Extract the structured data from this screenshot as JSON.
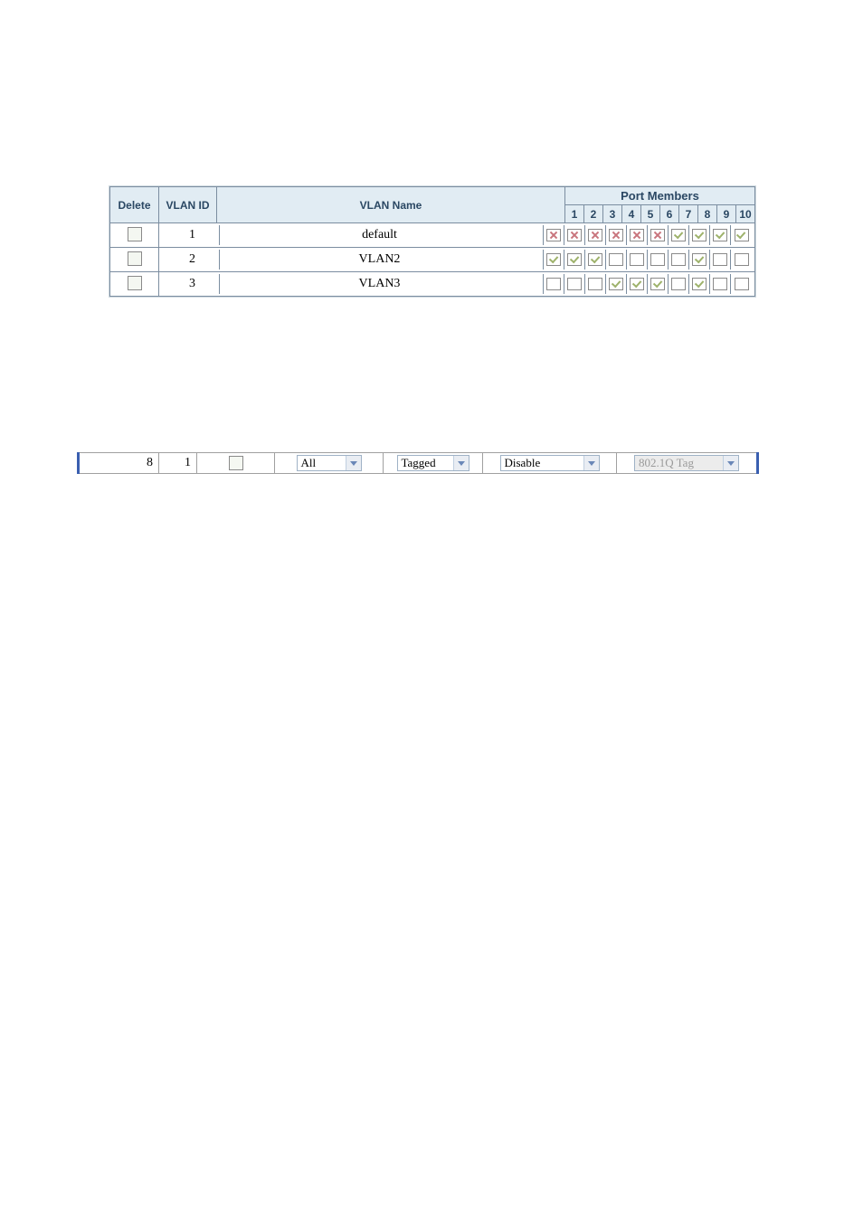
{
  "table": {
    "headers": {
      "delete": "Delete",
      "vlan_id": "VLAN ID",
      "vlan_name": "VLAN Name",
      "port_members": "Port Members",
      "ports": [
        "1",
        "2",
        "3",
        "4",
        "5",
        "6",
        "7",
        "8",
        "9",
        "10"
      ]
    },
    "rows": [
      {
        "vlan_id": "1",
        "vlan_name": "default",
        "delete_checked": false,
        "highlight_color": "#00d500",
        "ports": [
          "cross",
          "cross",
          "cross",
          "cross",
          "cross",
          "cross",
          "check",
          "check",
          "check",
          "check"
        ]
      },
      {
        "vlan_id": "2",
        "vlan_name": "VLAN2",
        "delete_checked": false,
        "highlight_color": "#e20808",
        "ports": [
          "check",
          "check",
          "check",
          "empty",
          "empty",
          "empty",
          "empty",
          "check",
          "empty",
          "empty"
        ]
      },
      {
        "vlan_id": "3",
        "vlan_name": "VLAN3",
        "delete_checked": false,
        "highlight_color": "#0a29d8",
        "ports": [
          "empty",
          "empty",
          "empty",
          "check",
          "check",
          "check",
          "empty",
          "check",
          "empty",
          "empty"
        ]
      }
    ]
  },
  "bottom_row": {
    "col1": "8",
    "col2": "1",
    "col3_checked": false,
    "dropdown1": "All",
    "dropdown2": "Tagged",
    "dropdown3": "Disable",
    "dropdown4": "802.1Q Tag",
    "dropdown4_disabled": true
  }
}
